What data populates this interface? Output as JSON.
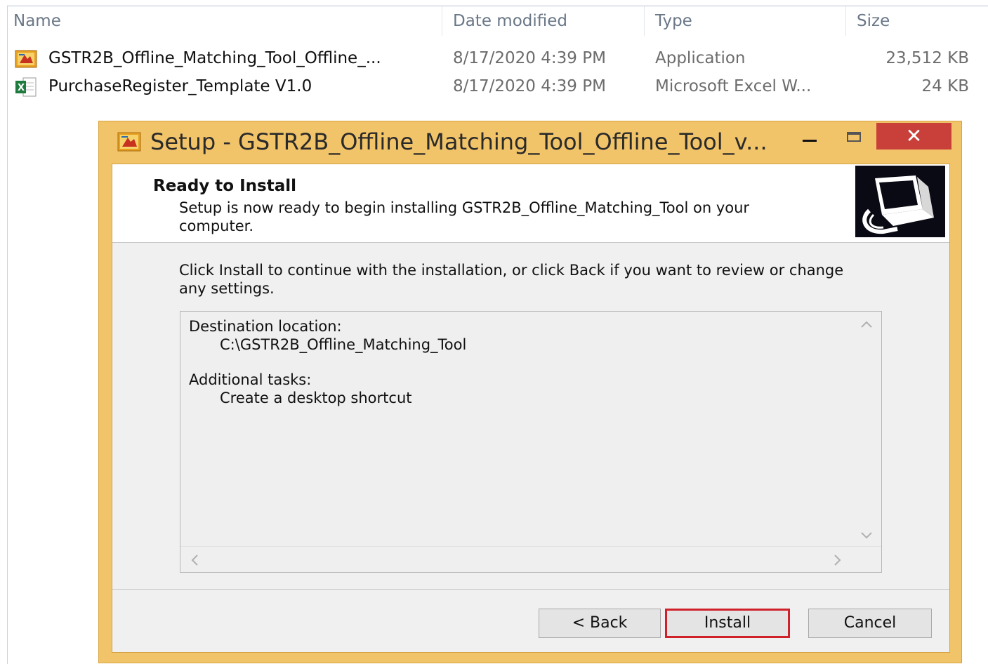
{
  "explorer": {
    "columns": {
      "name": "Name",
      "date": "Date modified",
      "type": "Type",
      "size": "Size"
    },
    "files": [
      {
        "name": "GSTR2B_Offline_Matching_Tool_Offline_...",
        "date": "8/17/2020 4:39 PM",
        "type": "Application",
        "size": "23,512 KB",
        "icon": "setup-app-icon"
      },
      {
        "name": "PurchaseRegister_Template V1.0",
        "date": "8/17/2020 4:39 PM",
        "type": "Microsoft Excel W...",
        "size": "24 KB",
        "icon": "excel-file-icon"
      }
    ]
  },
  "dialog": {
    "title": "Setup - GSTR2B_Offline_Matching_Tool_Offline_Tool_v...",
    "close_glyph": "✕",
    "heading": "Ready to Install",
    "subheading": "Setup is now ready to begin installing GSTR2B_Offline_Matching_Tool on your computer.",
    "instructions": "Click Install to continue with the installation, or click Back if you want to review or change any settings.",
    "memo": {
      "destination_label": "Destination location:",
      "destination_value": "C:\\GSTR2B_Offline_Matching_Tool",
      "tasks_label": "Additional tasks:",
      "tasks_value": "Create a desktop shortcut"
    },
    "buttons": {
      "back": "< Back",
      "install": "Install",
      "cancel": "Cancel"
    },
    "colors": {
      "frame": "#f2c46a",
      "close": "#c9403a",
      "install_highlight": "#d0202a"
    }
  }
}
